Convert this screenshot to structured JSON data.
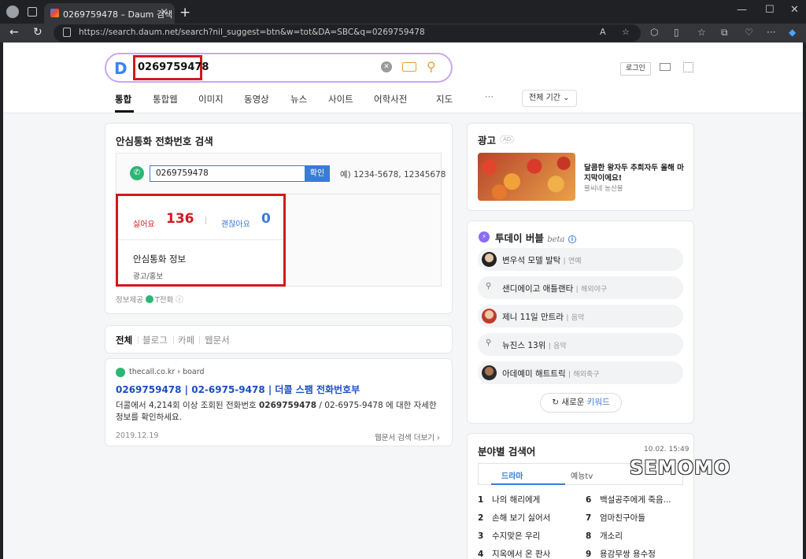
{
  "browser": {
    "tab_title": "0269759478 – Daum 검색",
    "url": "https://search.daum.net/search?nil_suggest=btn&w=tot&DA=SBC&q=0269759478"
  },
  "header": {
    "query": "0269759478",
    "login_label": "로그인",
    "tabs": [
      "통합",
      "통합웹",
      "이미지",
      "동영상",
      "뉴스",
      "사이트",
      "어학사전",
      "지도"
    ],
    "more": "···",
    "period_label": "전체 기간 ⌄"
  },
  "phone_check": {
    "title": "안심통화 전화번호 검색",
    "input_value": "0269759478",
    "confirm_label": "확인",
    "example": "예) 1234-5678, 12345678",
    "dislike_label": "싫어요",
    "dislike_count": "136",
    "ok_label": "괜찮아요",
    "ok_count": "0",
    "info_title": "안심통화 정보",
    "info_value": "광고/홍보",
    "provider_prefix": "정보제공",
    "provider_name": "T전화"
  },
  "result_tabs": [
    "전체",
    "블로그",
    "카페",
    "웹문서"
  ],
  "web_result": {
    "site": "thecall.co.kr › board",
    "title": "0269759478 | 02-6975-9478 | 더콜 스팸 전화번호부",
    "desc_pre": "더콜에서 4,214회 이상 조회된 전화번호 ",
    "desc_bold": "0269759478",
    "desc_post": " / 02-6975-9478 에 대한 자세한 정보를 확인하세요.",
    "date": "2019.12.19",
    "more": "웹문서 검색 더보기 ›"
  },
  "ad": {
    "title": "광고",
    "badge": "AD",
    "text": "달콤한 왕자두 추희자두 올해 마지막이에요!",
    "sub": "몰씨네 농산물"
  },
  "bubble": {
    "title": "투데이 버블",
    "beta": "beta",
    "info": "i",
    "items": [
      {
        "keyword": "변우석 모델 발탁",
        "category": "연예",
        "icon": "avatar"
      },
      {
        "keyword": "샌디에이고 애틀랜타",
        "category": "해외야구",
        "icon": "search-icon"
      },
      {
        "keyword": "제니 11일 만트라",
        "category": "음악",
        "icon": "avatar"
      },
      {
        "keyword": "뉴진스 13위",
        "category": "음악",
        "icon": "search-icon"
      },
      {
        "keyword": "아데예미 해트트릭",
        "category": "해외축구",
        "icon": "avatar"
      }
    ],
    "refresh_pre": "새로운 ",
    "refresh_kw": "키워드"
  },
  "field_keywords": {
    "title": "분야별 검색어",
    "time": "10.02. 15:49",
    "tabs": [
      "드라마",
      "예능tv"
    ],
    "left": [
      {
        "rank": "1",
        "text": "나의 해리에게"
      },
      {
        "rank": "2",
        "text": "손해 보기 싫어서"
      },
      {
        "rank": "3",
        "text": "수지맞은 우리"
      },
      {
        "rank": "4",
        "text": "지옥에서 온 판사"
      }
    ],
    "right": [
      {
        "rank": "6",
        "text": "백설공주에게 죽음..."
      },
      {
        "rank": "7",
        "text": "엄마친구아들"
      },
      {
        "rank": "8",
        "text": "개소리"
      },
      {
        "rank": "9",
        "text": "용감무쌍 용수정"
      }
    ]
  },
  "watermark": "SEMOMO"
}
